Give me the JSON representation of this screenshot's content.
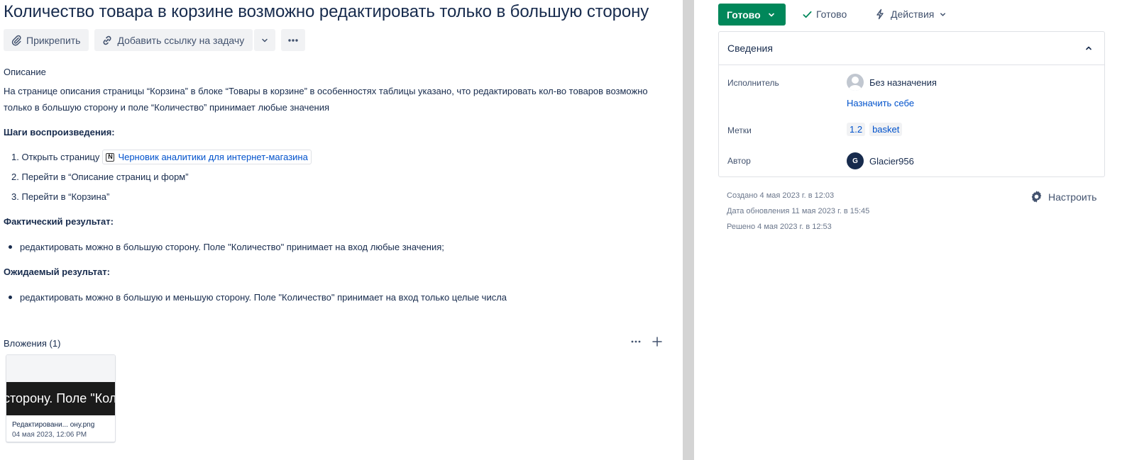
{
  "issue": {
    "title": "Количество товара в корзине возможно редактировать только в большую сторону"
  },
  "toolbar": {
    "attach_label": "Прикрепить",
    "link_issue_label": "Добавить ссылку на задачу"
  },
  "description": {
    "label": "Описание",
    "text": "На странице описания страницы “Корзина” в блоке “Товары в корзине” в особенностях таблицы указано, что редактировать кол-во товаров возможно только в большую сторону и поле “Количество” принимает любые значения",
    "steps_heading": "Шаги воспроизведения:",
    "steps": [
      {
        "number": "1.",
        "text": "Открыть страницу",
        "link": "Черновик аналитики для интернет-магазина"
      },
      {
        "number": "2.",
        "text": "Перейти в “Описание страниц и форм”"
      },
      {
        "number": "3.",
        "text": "Перейти в “Корзина”"
      }
    ],
    "actual_heading": "Фактический результат:",
    "actual_items": [
      "редактировать можно в большую сторону. Поле \"Количество\" принимает на вход любые значения;"
    ],
    "expected_heading": "Ожидаемый результат:",
    "expected_items": [
      "редактировать можно в большую и меньшую сторону. Поле \"Количество\" принимает на вход только целые числа"
    ]
  },
  "attachments": {
    "label": "Вложения (1)",
    "items": [
      {
        "preview_text": "сторону. Поле \"Коли",
        "name": "Редактировани... ону.png",
        "date": "04 мая 2023, 12:06 PM"
      }
    ]
  },
  "status": {
    "button_label": "Готово",
    "resolution_label": "Готово",
    "actions_label": "Действия",
    "button_color": "#00875a"
  },
  "details": {
    "title": "Сведения",
    "assignee_label": "Исполнитель",
    "assignee_value": "Без назначения",
    "assign_to_me": "Назначить себе",
    "labels_label": "Метки",
    "labels": [
      "1.2",
      "basket"
    ],
    "reporter_label": "Автор",
    "reporter_initial": "G",
    "reporter_value": "Glacier956"
  },
  "meta": {
    "created": "Создано 4 мая 2023 г. в 12:03",
    "updated": "Дата обновления 11 мая 2023 г. в 15:45",
    "resolved": "Решено 4 мая 2023 г. в 12:53",
    "configure_label": "Настроить"
  },
  "icons": {
    "attach": "paperclip-icon",
    "link": "link-icon",
    "chevron": "chevron-down-icon",
    "more": "more-icon",
    "check": "check-icon",
    "lightning": "lightning-icon",
    "collapse": "chevron-up-icon",
    "gear": "gear-icon",
    "add": "plus-icon",
    "page": "notion-page-icon"
  }
}
